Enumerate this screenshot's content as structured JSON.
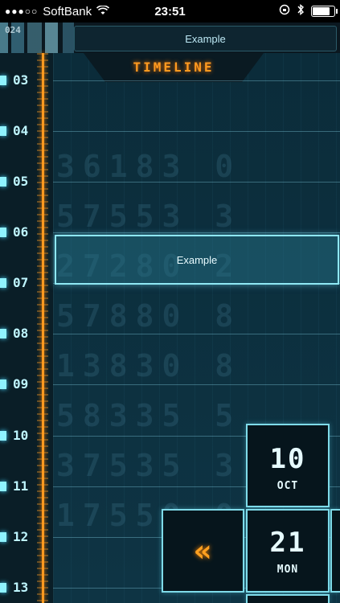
{
  "status": {
    "signal": "●●●○○",
    "carrier": "SoftBank",
    "time": "23:51",
    "battery_percent": 85
  },
  "header": {
    "title": "Example",
    "code": "024"
  },
  "timeline_label": "TIMELINE",
  "hours": [
    "03",
    "04",
    "05",
    "06",
    "07",
    "08",
    "09",
    "10",
    "11",
    "12",
    "13"
  ],
  "event": {
    "title": "Example"
  },
  "date_widget": {
    "month_day": "10",
    "month": "OCT",
    "day": "21",
    "weekday": "MON",
    "prev_icon": "«"
  },
  "colors": {
    "accent_orange": "#ff9a20",
    "accent_cyan": "#8ff3ff",
    "background": "#0b2c3a"
  }
}
